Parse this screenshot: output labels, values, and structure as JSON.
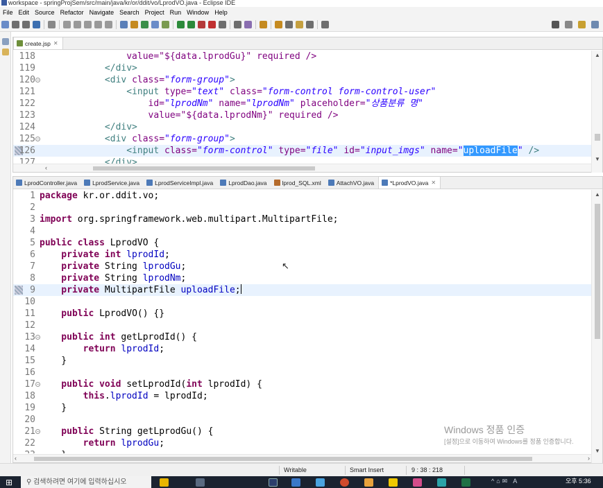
{
  "window": {
    "title": "workspace - springProjSem/src/main/java/kr/or/ddit/vo/LprodVO.java - Eclipse IDE"
  },
  "menu": [
    "File",
    "Edit",
    "Source",
    "Refactor",
    "Navigate",
    "Search",
    "Project",
    "Run",
    "Window",
    "Help"
  ],
  "top_editor": {
    "tab": "create.jsp",
    "lines": [
      {
        "n": "118",
        "parts": [
          {
            "t": "                value=\"${data.lprodGu}\" required />",
            "c": "at"
          }
        ]
      },
      {
        "n": "119",
        "parts": [
          {
            "t": "            </div>",
            "c": "tg"
          }
        ]
      },
      {
        "n": "120",
        "fold": true,
        "parts": [
          {
            "t": "            <div ",
            "c": "tg"
          },
          {
            "t": "class=",
            "c": "at"
          },
          {
            "t": "\"form-group\"",
            "c": "sv"
          },
          {
            "t": ">",
            "c": "tg"
          }
        ]
      },
      {
        "n": "121",
        "parts": [
          {
            "t": "                <input ",
            "c": "tg"
          },
          {
            "t": "type=",
            "c": "at"
          },
          {
            "t": "\"text\"",
            "c": "sv"
          },
          {
            "t": " class=",
            "c": "at"
          },
          {
            "t": "\"form-control form-control-user\"",
            "c": "sv"
          }
        ]
      },
      {
        "n": "122",
        "parts": [
          {
            "t": "                    id=",
            "c": "at"
          },
          {
            "t": "\"lprodNm\"",
            "c": "sv"
          },
          {
            "t": " name=",
            "c": "at"
          },
          {
            "t": "\"lprodNm\"",
            "c": "sv"
          },
          {
            "t": " placeholder=",
            "c": "at"
          },
          {
            "t": "\"상품분류 명\"",
            "c": "sv"
          }
        ]
      },
      {
        "n": "123",
        "parts": [
          {
            "t": "                    value=\"${data.lprodNm}\" required />",
            "c": "at"
          }
        ]
      },
      {
        "n": "124",
        "parts": [
          {
            "t": "            </div>",
            "c": "tg"
          }
        ]
      },
      {
        "n": "125",
        "fold": true,
        "parts": [
          {
            "t": "            <div ",
            "c": "tg"
          },
          {
            "t": "class=",
            "c": "at"
          },
          {
            "t": "\"form-group\"",
            "c": "sv"
          },
          {
            "t": ">",
            "c": "tg"
          }
        ]
      },
      {
        "n": "126",
        "hl": true,
        "mark": true,
        "parts": [
          {
            "t": "                <input ",
            "c": "tg"
          },
          {
            "t": "class=",
            "c": "at"
          },
          {
            "t": "\"form-control\"",
            "c": "sv"
          },
          {
            "t": " type=",
            "c": "at"
          },
          {
            "t": "\"file\"",
            "c": "sv"
          },
          {
            "t": " id=",
            "c": "at"
          },
          {
            "t": "\"input_imgs\"",
            "c": "sv"
          },
          {
            "t": " name=",
            "c": "at"
          },
          {
            "t": "\"",
            "c": "sv"
          },
          {
            "t": "uploadFile",
            "c": "sel"
          },
          {
            "t": "\"",
            "c": "sv"
          },
          {
            "t": " />",
            "c": "tg"
          }
        ]
      },
      {
        "n": "127",
        "parts": [
          {
            "t": "            </div>",
            "c": "tg"
          }
        ]
      }
    ]
  },
  "bottom_editor": {
    "tabs": [
      {
        "label": "LprodController.java",
        "icon": "java"
      },
      {
        "label": "LprodService.java",
        "icon": "java"
      },
      {
        "label": "LprodServiceImpl.java",
        "icon": "java"
      },
      {
        "label": "LprodDao.java",
        "icon": "java"
      },
      {
        "label": "lprod_SQL.xml",
        "icon": "xml"
      },
      {
        "label": "AttachVO.java",
        "icon": "java"
      },
      {
        "label": "*LprodVO.java",
        "icon": "java",
        "active": true
      }
    ],
    "lines": [
      {
        "n": "1",
        "parts": [
          {
            "t": "package",
            "c": "k"
          },
          {
            "t": " kr.or.ddit.vo;",
            "c": ""
          }
        ]
      },
      {
        "n": "2",
        "parts": []
      },
      {
        "n": "3",
        "parts": [
          {
            "t": "import",
            "c": "k"
          },
          {
            "t": " org.springframework.web.multipart.MultipartFile;",
            "c": ""
          }
        ]
      },
      {
        "n": "4",
        "parts": []
      },
      {
        "n": "5",
        "parts": [
          {
            "t": "public class",
            "c": "k"
          },
          {
            "t": " LprodVO {",
            "c": ""
          }
        ]
      },
      {
        "n": "6",
        "parts": [
          {
            "t": "    private int",
            "c": "k"
          },
          {
            "t": " ",
            "c": ""
          },
          {
            "t": "lprodId",
            "c": "f"
          },
          {
            "t": ";",
            "c": ""
          }
        ]
      },
      {
        "n": "7",
        "parts": [
          {
            "t": "    private",
            "c": "k"
          },
          {
            "t": " String ",
            "c": ""
          },
          {
            "t": "lprodGu",
            "c": "f"
          },
          {
            "t": ";",
            "c": ""
          }
        ]
      },
      {
        "n": "8",
        "parts": [
          {
            "t": "    private",
            "c": "k"
          },
          {
            "t": " String ",
            "c": ""
          },
          {
            "t": "lprodNm",
            "c": "f"
          },
          {
            "t": ";",
            "c": ""
          }
        ]
      },
      {
        "n": "9",
        "hl": true,
        "mark": true,
        "parts": [
          {
            "t": "    private",
            "c": "k"
          },
          {
            "t": " MultipartFile ",
            "c": ""
          },
          {
            "t": "uploadFile",
            "c": "f"
          },
          {
            "t": ";",
            "c": ""
          }
        ]
      },
      {
        "n": "10",
        "parts": []
      },
      {
        "n": "11",
        "parts": [
          {
            "t": "    public",
            "c": "k"
          },
          {
            "t": " LprodVO() {}",
            "c": ""
          }
        ]
      },
      {
        "n": "12",
        "parts": []
      },
      {
        "n": "13",
        "fold": true,
        "parts": [
          {
            "t": "    public int",
            "c": "k"
          },
          {
            "t": " getLprodId() {",
            "c": ""
          }
        ]
      },
      {
        "n": "14",
        "parts": [
          {
            "t": "        return",
            "c": "k"
          },
          {
            "t": " ",
            "c": ""
          },
          {
            "t": "lprodId",
            "c": "f"
          },
          {
            "t": ";",
            "c": ""
          }
        ]
      },
      {
        "n": "15",
        "parts": [
          {
            "t": "    }",
            "c": ""
          }
        ]
      },
      {
        "n": "16",
        "parts": []
      },
      {
        "n": "17",
        "fold": true,
        "parts": [
          {
            "t": "    public void",
            "c": "k"
          },
          {
            "t": " setLprodId(",
            "c": ""
          },
          {
            "t": "int",
            "c": "k"
          },
          {
            "t": " lprodId) {",
            "c": ""
          }
        ]
      },
      {
        "n": "18",
        "parts": [
          {
            "t": "        this",
            "c": "k"
          },
          {
            "t": ".",
            "c": ""
          },
          {
            "t": "lprodId",
            "c": "f"
          },
          {
            "t": " = lprodId;",
            "c": ""
          }
        ]
      },
      {
        "n": "19",
        "parts": [
          {
            "t": "    }",
            "c": ""
          }
        ]
      },
      {
        "n": "20",
        "parts": []
      },
      {
        "n": "21",
        "fold": true,
        "parts": [
          {
            "t": "    public",
            "c": "k"
          },
          {
            "t": " String getLprodGu() {",
            "c": ""
          }
        ]
      },
      {
        "n": "22",
        "parts": [
          {
            "t": "        return",
            "c": "k"
          },
          {
            "t": " ",
            "c": ""
          },
          {
            "t": "lprodGu",
            "c": "f"
          },
          {
            "t": ";",
            "c": ""
          }
        ]
      },
      {
        "n": "23",
        "parts": [
          {
            "t": "    }",
            "c": ""
          }
        ]
      }
    ]
  },
  "status": {
    "mode": "Writable",
    "insert": "Smart Insert",
    "position": "9 : 38 : 218"
  },
  "watermark": {
    "title": "Windows 정품 인증",
    "body": "[설정]으로 이동하여 Windows를 정품 인증합니다."
  },
  "taskbar": {
    "search_placeholder": "검색하려면 여기에 입력하십시오",
    "time": "오후 5:36"
  },
  "colors": {
    "keyword": "#7f0055",
    "field": "#0000c0",
    "string": "#2a00ff",
    "attribute": "#7f007f",
    "tag": "#3f7f7f",
    "selection": "#3399ff",
    "current_line": "#e8f2fe"
  }
}
